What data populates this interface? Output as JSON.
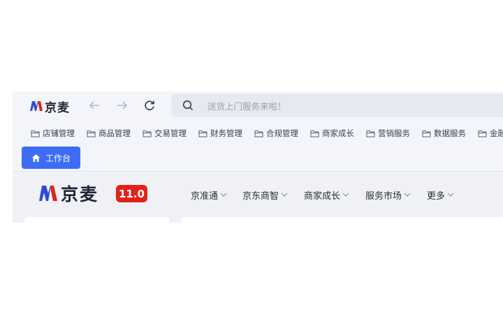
{
  "app": {
    "logo_text": "京麦",
    "search_placeholder": "送货上门服务来啦！"
  },
  "bookmarks": [
    {
      "label": "店铺管理"
    },
    {
      "label": "商品管理"
    },
    {
      "label": "交易管理"
    },
    {
      "label": "财务管理"
    },
    {
      "label": "合规管理"
    },
    {
      "label": "商家成长"
    },
    {
      "label": "营销服务"
    },
    {
      "label": "数据服务"
    },
    {
      "label": "金融"
    }
  ],
  "tabs": [
    {
      "label": "工作台",
      "icon": "home-icon"
    }
  ],
  "header": {
    "logo_text": "京麦",
    "version": "11.0",
    "nav": [
      {
        "label": "京准通"
      },
      {
        "label": "京东商智"
      },
      {
        "label": "商家成长"
      },
      {
        "label": "服务市场"
      },
      {
        "label": "更多"
      }
    ]
  },
  "colors": {
    "accent": "#3d6df5",
    "brand_red": "#e2231a",
    "brand_blue": "#2f4bd6"
  }
}
